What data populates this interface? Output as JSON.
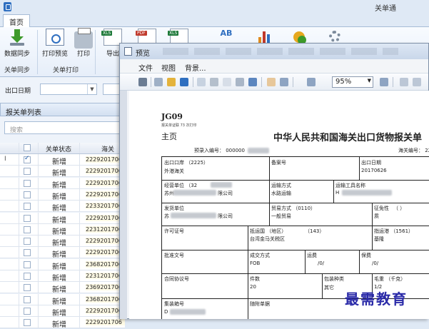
{
  "window": {
    "title": "关单通"
  },
  "ribbon": {
    "tabs": [
      "首页"
    ],
    "buttons": {
      "sync": "数据同步",
      "print_preview": "打印预览",
      "print": "打印",
      "export": "导出",
      "xls_badge": "XLS",
      "pdf_badge": "PDF",
      "ab_label": "AB"
    },
    "groups": {
      "sync": "关单同步",
      "print": "关单打印"
    }
  },
  "filters": {
    "export_date_label": "出口日期"
  },
  "list": {
    "title": "报关单列表",
    "search_placeholder": "搜索",
    "columns": {
      "status": "关单状态",
      "number": "海关"
    },
    "rows": [
      {
        "mark": "I",
        "checked": true,
        "status": "新增",
        "number": "2229201706"
      },
      {
        "mark": "",
        "checked": false,
        "status": "新增",
        "number": "2229201706"
      },
      {
        "mark": "",
        "checked": false,
        "status": "新增",
        "number": "2229201706"
      },
      {
        "mark": "",
        "checked": false,
        "status": "新增",
        "number": "2229201706"
      },
      {
        "mark": "",
        "checked": false,
        "status": "新增",
        "number": "2233201706"
      },
      {
        "mark": "",
        "checked": false,
        "status": "新增",
        "number": "2229201706"
      },
      {
        "mark": "",
        "checked": false,
        "status": "新增",
        "number": "2231201706"
      },
      {
        "mark": "",
        "checked": false,
        "status": "新增",
        "number": "2229201706"
      },
      {
        "mark": "",
        "checked": false,
        "status": "新增",
        "number": "2229201706"
      },
      {
        "mark": "",
        "checked": false,
        "status": "新增",
        "number": "2368201706"
      },
      {
        "mark": "",
        "checked": false,
        "status": "新增",
        "number": "2231201706"
      },
      {
        "mark": "",
        "checked": false,
        "status": "新增",
        "number": "2369201706"
      },
      {
        "mark": "",
        "checked": false,
        "status": "新增",
        "number": "2368201706"
      },
      {
        "mark": "",
        "checked": false,
        "status": "新增",
        "number": "2229201706"
      },
      {
        "mark": "",
        "checked": false,
        "status": "新增",
        "number": "2229201706"
      }
    ]
  },
  "preview": {
    "title": "预览",
    "menu": [
      "文件",
      "视图",
      "背景..."
    ],
    "zoom": "95%",
    "document": {
      "code": "JG09",
      "sub": "报关单证联 73 次打印",
      "home": "主页",
      "title": "中华人民共和国海关出口货物报关单",
      "entry_no": "预录入编号： 000000",
      "customs_no": "海关编号： 22",
      "fields": {
        "export_port_lbl": "出口口岸 （2225）",
        "export_port_val": "外港海关",
        "record_no_lbl": "备案号",
        "export_date_lbl": "出口日期",
        "export_date_val": "20170626",
        "operator_lbl": "经营单位 （32",
        "operator_val": "苏州",
        "operator_val2": "限公司",
        "transport_lbl": "运输方式",
        "transport_val": "水路运输",
        "vessel_lbl": "运输工具名称",
        "vessel_val": "H",
        "consignor_lbl": "发货单位",
        "consignor_val": "苏",
        "consignor_val2": "限公司",
        "trade_mode_lbl": "贸易方式 （0110）",
        "trade_mode_val": "一般贸易",
        "tax_lbl": "征免性",
        "tax_val": "（ ）",
        "tax_val2": "质",
        "license_lbl": "许可证号",
        "country_lbl": "抵运国 （地区）",
        "country_code": "（143）",
        "country_val": "台湾金马关税区",
        "port_dest_lbl": "指运港 （1561）",
        "port_dest_val": "基隆",
        "approval_lbl": "批准文号",
        "deal_lbl": "成交方式",
        "deal_val": "FOB",
        "freight_lbl": "运费",
        "freight_val": "/0/",
        "insurance_lbl": "保费",
        "insurance_val": "/0/",
        "contract_lbl": "合同协议号",
        "pieces_lbl": "件数",
        "pieces_val": "20",
        "pack_lbl": "包装种类",
        "pack_val": "其它",
        "gross_lbl": "毛重 （千克）",
        "gross_val": "1/2",
        "container_lbl": "集装箱号",
        "container_val": "D",
        "docs_lbl": "随附单据"
      }
    }
  },
  "watermark": "最需教育"
}
